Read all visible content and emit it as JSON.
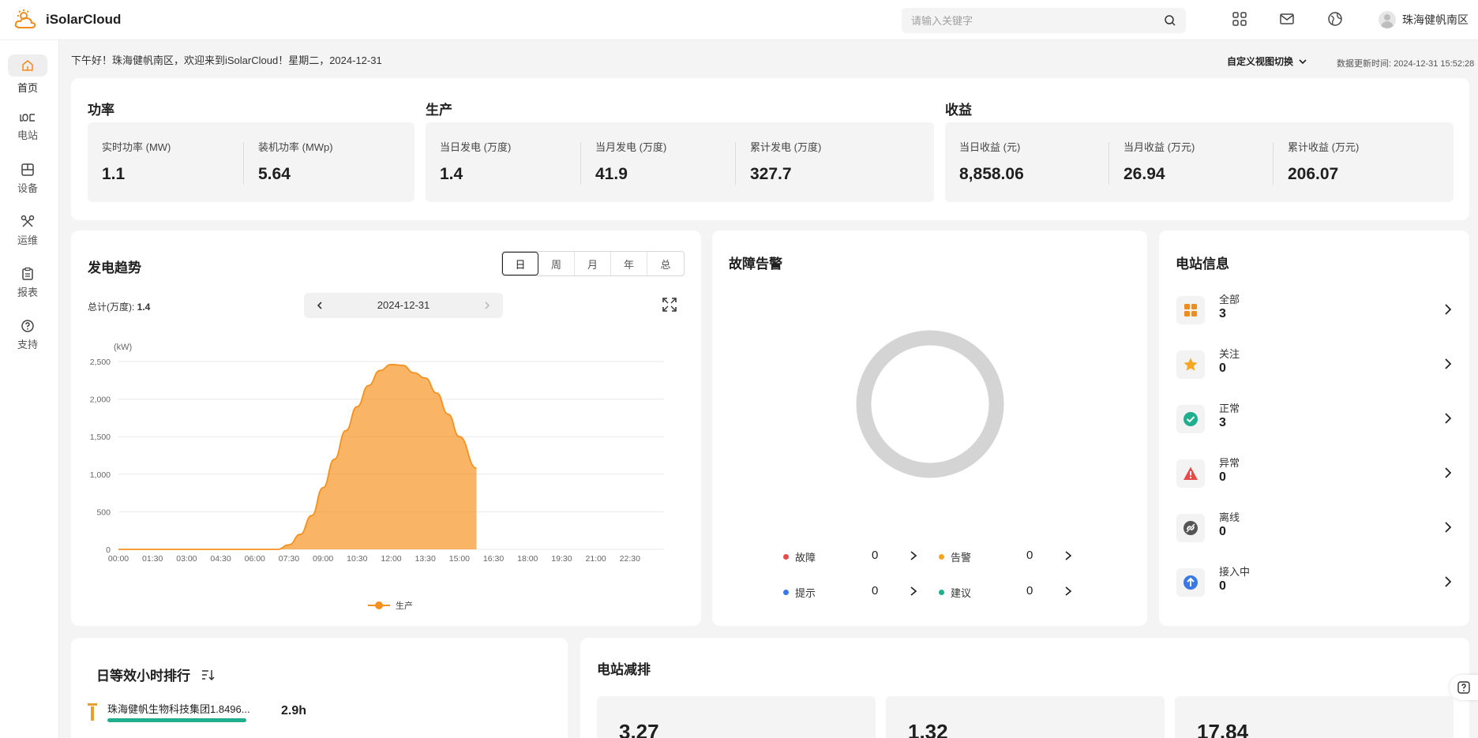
{
  "app": {
    "name": "iSolarCloud",
    "brand_color": "#f08c1e"
  },
  "header": {
    "search_placeholder": "请输入关键字",
    "username": "珠海健帆南区",
    "icons": [
      "apps-icon",
      "mail-icon",
      "globe-icon"
    ]
  },
  "sidebar": {
    "items": [
      {
        "label": "首页",
        "icon": "home-icon",
        "active": true
      },
      {
        "label": "电站",
        "icon": "plant-icon"
      },
      {
        "label": "设备",
        "icon": "device-icon"
      },
      {
        "label": "运维",
        "icon": "tools-icon"
      },
      {
        "label": "报表",
        "icon": "report-icon"
      },
      {
        "label": "支持",
        "icon": "help-icon"
      }
    ]
  },
  "greeting": "下午好！珠海健帆南区，欢迎来到iSolarCloud！星期二，2024-12-31",
  "view_switch": "自定义视图切换",
  "update_time": "数据更新时间: 2024-12-31 15:52:28",
  "power": {
    "title": "功率",
    "stats": [
      {
        "label": "实时功率 (MW)",
        "value": "1.1"
      },
      {
        "label": "装机功率 (MWp)",
        "value": "5.64"
      }
    ]
  },
  "production": {
    "title": "生产",
    "stats": [
      {
        "label": "当日发电 (万度)",
        "value": "1.4"
      },
      {
        "label": "当月发电 (万度)",
        "value": "41.9"
      },
      {
        "label": "累计发电 (万度)",
        "value": "327.7"
      }
    ]
  },
  "revenue": {
    "title": "收益",
    "stats": [
      {
        "label": "当日收益 (元)",
        "value": "8,858.06"
      },
      {
        "label": "当月收益 (万元)",
        "value": "26.94"
      },
      {
        "label": "累计收益 (万元)",
        "value": "206.07"
      }
    ]
  },
  "trend": {
    "title": "发电趋势",
    "tabs": [
      "日",
      "周",
      "月",
      "年",
      "总"
    ],
    "active_tab": "日",
    "total_label": "总计(万度):",
    "total_value": "1.4",
    "date": "2024-12-31"
  },
  "chart_data": {
    "type": "area",
    "ylabel": "(kW)",
    "ylim": [
      0,
      2500
    ],
    "yticks": [
      "0",
      "500",
      "1,000",
      "1,500",
      "2,000",
      "2,500"
    ],
    "xticks": [
      "00:00",
      "01:30",
      "03:00",
      "04:30",
      "06:00",
      "07:30",
      "09:00",
      "10:30",
      "12:00",
      "13:30",
      "15:00",
      "16:30",
      "18:00",
      "19:30",
      "21:00",
      "22:30"
    ],
    "color": "#f7901e",
    "series": [
      {
        "name": "生产",
        "x": [
          "00:00",
          "06:00",
          "07:00",
          "07:30",
          "08:00",
          "08:30",
          "09:00",
          "09:30",
          "10:00",
          "10:30",
          "11:00",
          "11:30",
          "12:00",
          "12:30",
          "13:00",
          "13:30",
          "14:00",
          "14:30",
          "15:00",
          "15:45"
        ],
        "values": [
          0,
          0,
          0,
          60,
          200,
          450,
          820,
          1200,
          1580,
          1900,
          2180,
          2380,
          2460,
          2450,
          2350,
          2280,
          2080,
          1800,
          1500,
          1080
        ]
      }
    ],
    "grid": true,
    "legend": "bottom-center"
  },
  "faults": {
    "title": "故障告警",
    "ring_color": "#d4d4d4",
    "items": [
      {
        "label": "故障",
        "value": "0",
        "color": "#e84a4a"
      },
      {
        "label": "告警",
        "value": "0",
        "color": "#f5a623"
      },
      {
        "label": "提示",
        "value": "0",
        "color": "#3b78e7"
      },
      {
        "label": "建议",
        "value": "0",
        "color": "#1fae8e"
      }
    ]
  },
  "station_info": {
    "title": "电站信息",
    "items": [
      {
        "label": "全部",
        "value": "3",
        "icon": "grid-icon",
        "color": "#f08c1e"
      },
      {
        "label": "关注",
        "value": "0",
        "icon": "star-icon",
        "color": "#f5a623"
      },
      {
        "label": "正常",
        "value": "3",
        "icon": "check-icon",
        "color": "#1fae8e"
      },
      {
        "label": "异常",
        "value": "0",
        "icon": "warning-icon",
        "color": "#e84a4a"
      },
      {
        "label": "离线",
        "value": "0",
        "icon": "offline-icon",
        "color": "#555555"
      },
      {
        "label": "接入中",
        "value": "0",
        "icon": "upload-icon",
        "color": "#3b78e7"
      }
    ]
  },
  "ranking": {
    "title": "日等效小时排行",
    "rows": [
      {
        "name": "珠海健帆生物科技集团1.8496...",
        "value": "2.9h"
      }
    ]
  },
  "reduction": {
    "title": "电站减排",
    "values": [
      "3.27",
      "1.32",
      "17.84"
    ]
  }
}
